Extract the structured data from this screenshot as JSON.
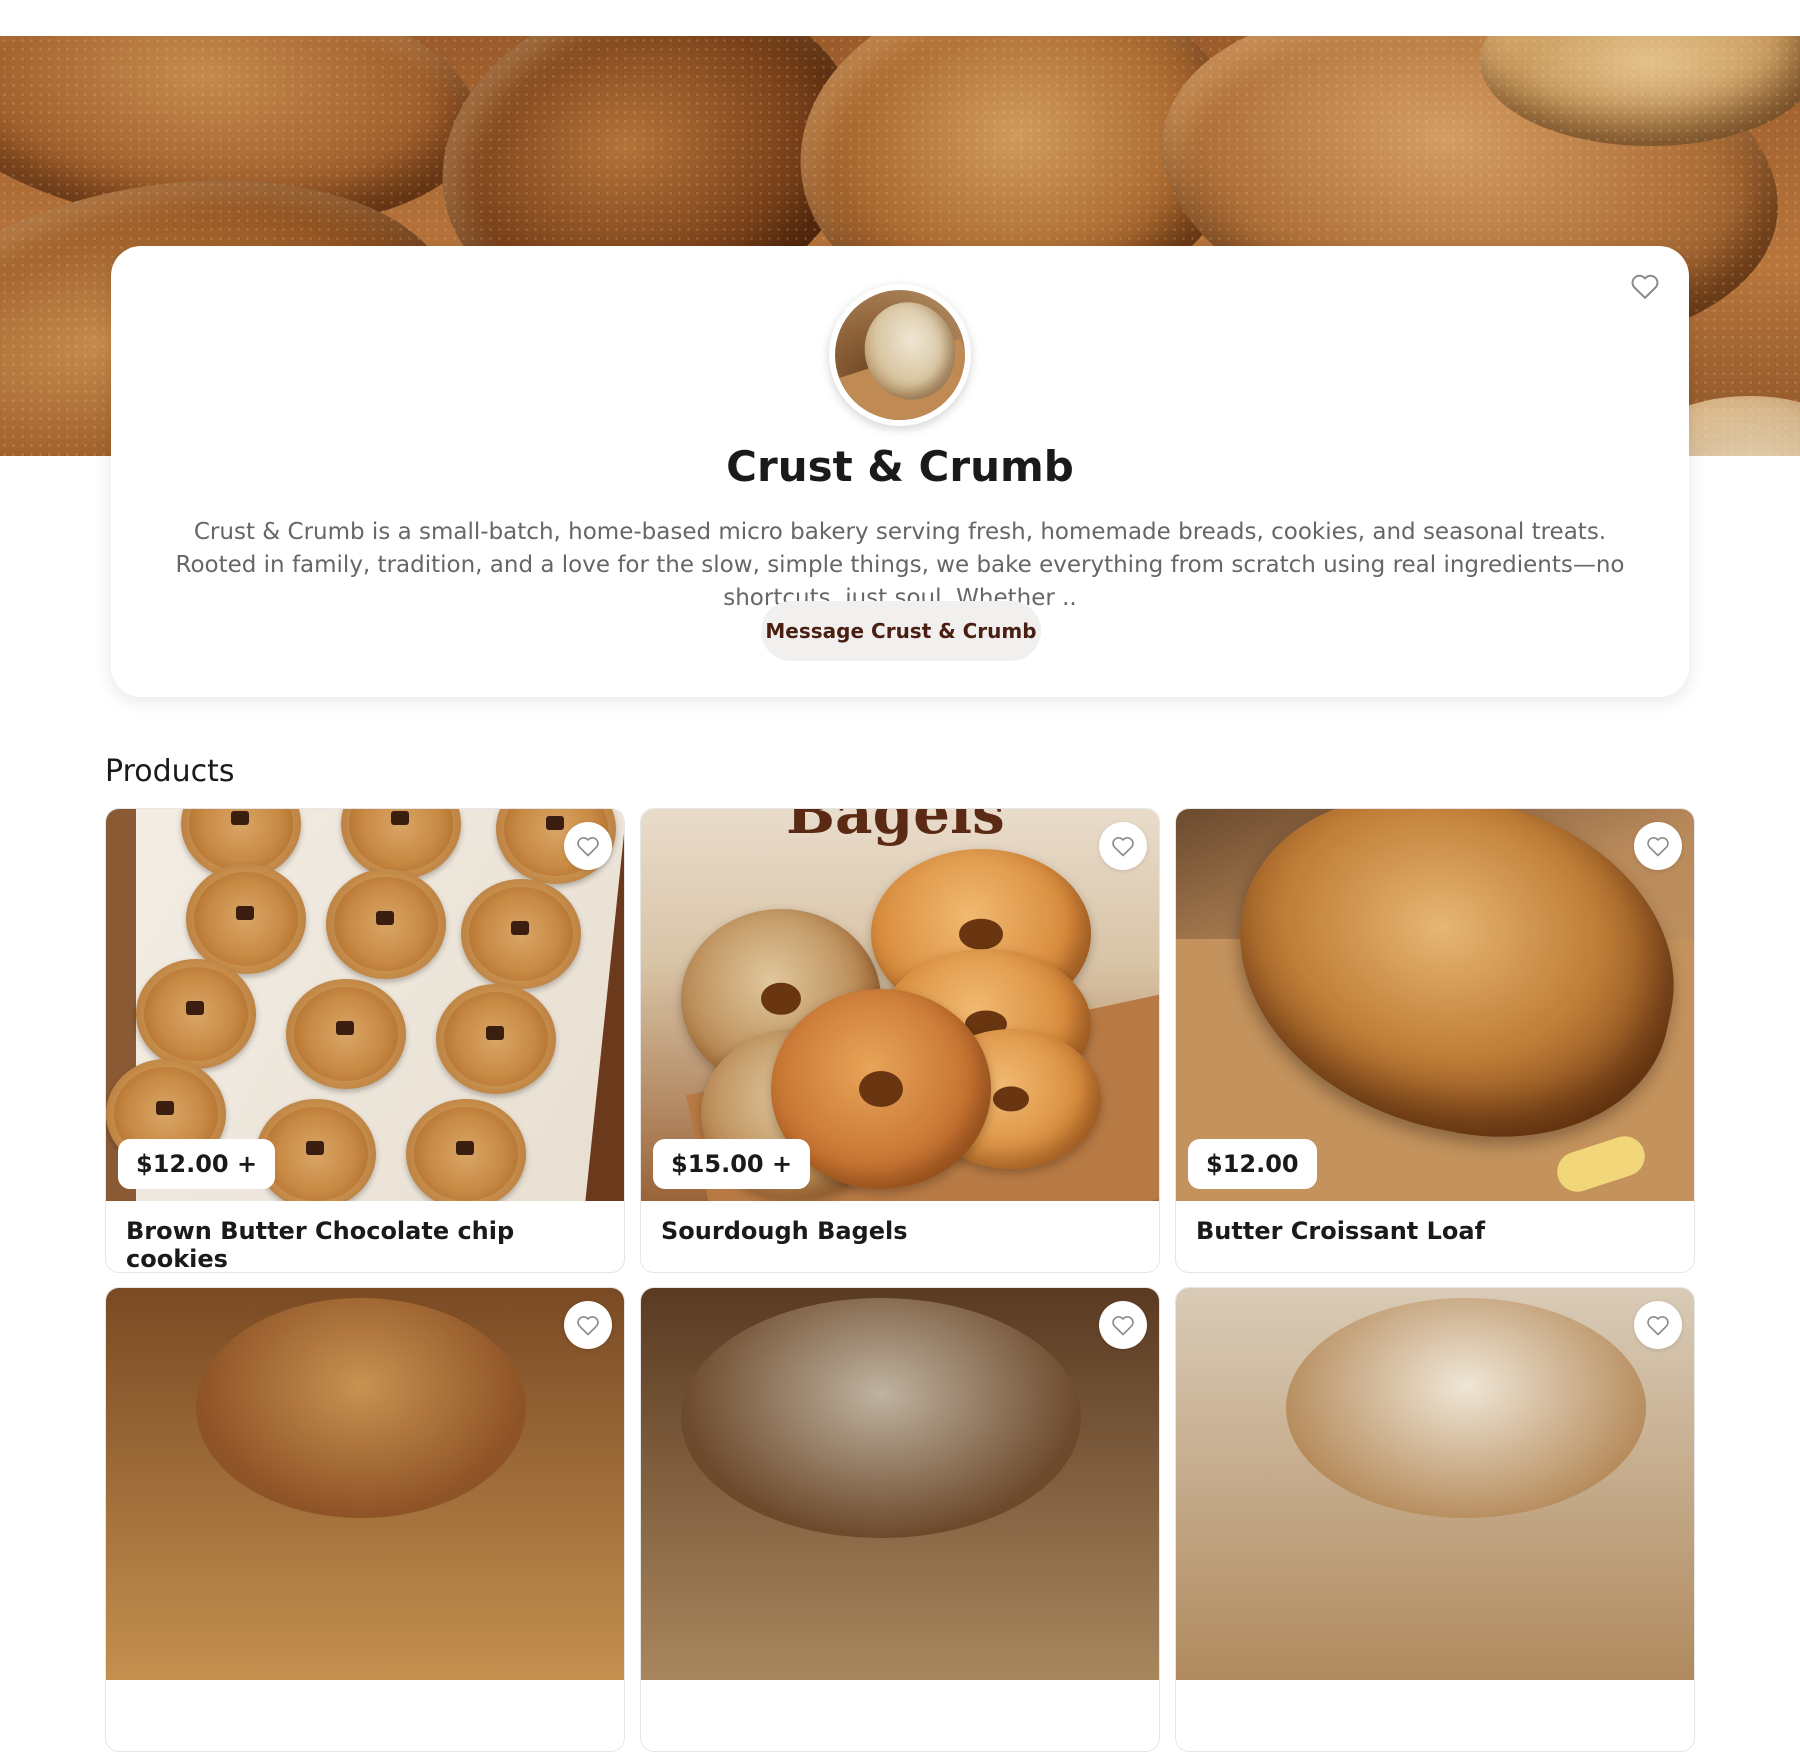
{
  "store": {
    "name": "Crust & Crumb",
    "description": "Crust & Crumb is a small-batch, home-based micro bakery serving fresh, homemade breads, cookies, and seasonal treats. Rooted in family, tradition, and a love for the slow, simple things, we bake everything from scratch using real ingredients—no shortcuts, just soul.  Whether ..",
    "message_button": "Message Crust & Crumb",
    "favorite_icon": "heart-outline-icon"
  },
  "products_section": {
    "title": "Products",
    "items": [
      {
        "title": "Brown Butter Chocolate chip cookies",
        "price": "$12.00 +"
      },
      {
        "title": "Sourdough Bagels",
        "price": "$15.00 +"
      },
      {
        "title": "Butter Croissant Loaf",
        "price": "$12.00"
      }
    ]
  },
  "product_image_text": {
    "bagels_banner": "Bagels"
  },
  "colors": {
    "message_text": "#4a1f12",
    "message_bg": "#f1f0ef",
    "description_text": "#666666"
  }
}
